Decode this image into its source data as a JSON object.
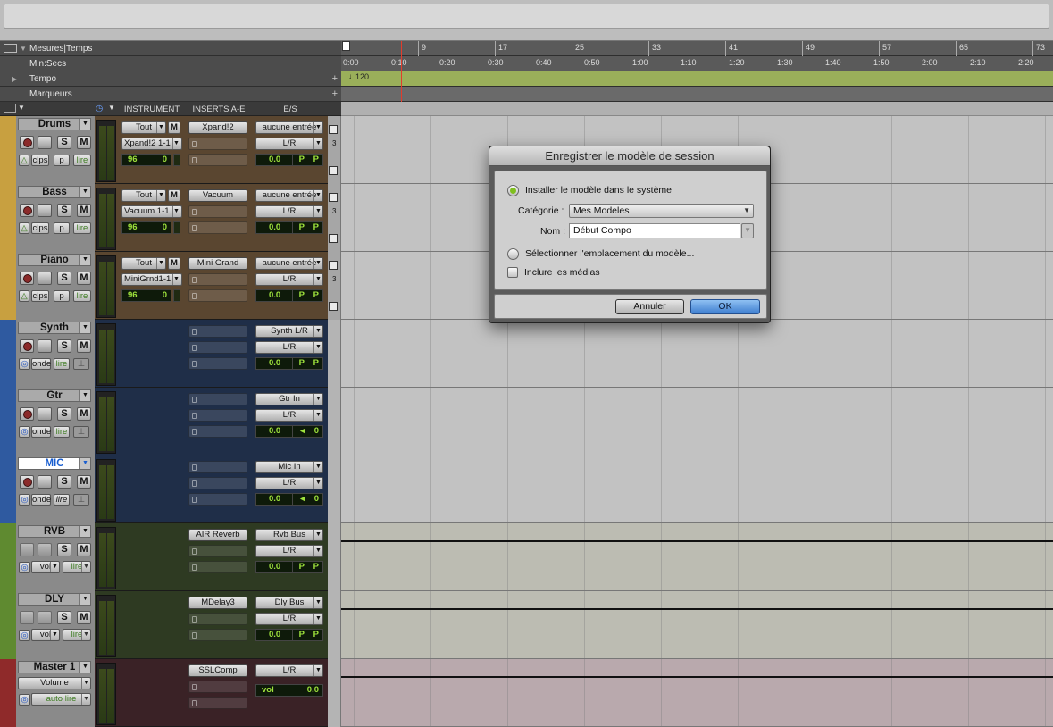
{
  "rulers": {
    "bars_label": "Mesures|Temps",
    "minsecs_label": "Min:Secs",
    "tempo_label": "Tempo",
    "markers_label": "Marqueurs",
    "tempo_value": "120",
    "bar_ticks": [
      "9",
      "17",
      "25",
      "33",
      "41",
      "49",
      "57",
      "65",
      "73"
    ],
    "time_ticks": [
      "0:00",
      "0:10",
      "0:20",
      "0:30",
      "0:40",
      "0:50",
      "1:00",
      "1:10",
      "1:20",
      "1:30",
      "1:40",
      "1:50",
      "2:00",
      "2:10",
      "2:20"
    ]
  },
  "mix_header": {
    "instrument": "INSTRUMENT",
    "inserts": "INSERTS A-E",
    "io": "E/S"
  },
  "tracks": [
    {
      "name": "Drums",
      "instr": "Tout",
      "plugin": "Xpand!2 1-1",
      "vol": "96",
      "pan": "0",
      "insert": "Xpand!2",
      "io_in": "aucune entrée",
      "io_out": "L/R",
      "fader": "0.0",
      "t1": "clps",
      "t2": "p",
      "t3": "lire"
    },
    {
      "name": "Bass",
      "instr": "Tout",
      "plugin": "Vacuum 1-1",
      "vol": "96",
      "pan": "0",
      "insert": "Vacuum",
      "io_in": "aucune entrée",
      "io_out": "L/R",
      "fader": "0.0",
      "t1": "clps",
      "t2": "p",
      "t3": "lire"
    },
    {
      "name": "Piano",
      "instr": "Tout",
      "plugin": "MiniGrnd1-1",
      "vol": "96",
      "pan": "0",
      "insert": "Mini Grand",
      "io_in": "aucune entrée",
      "io_out": "L/R",
      "fader": "0.0",
      "t1": "clps",
      "t2": "p",
      "t3": "lire"
    },
    {
      "name": "Synth",
      "io_in": "Synth L/R",
      "io_out": "L/R",
      "fader": "0.0",
      "t1": "onde",
      "t3": "lire"
    },
    {
      "name": "Gtr",
      "io_in": "Gtr In",
      "io_out": "L/R",
      "fader": "0.0",
      "pan": "0",
      "t1": "onde",
      "t3": "lire"
    },
    {
      "name": "MIC",
      "io_in": "Mic In",
      "io_out": "L/R",
      "fader": "0.0",
      "pan": "0",
      "t1": "onde",
      "t3": "lire"
    },
    {
      "name": "RVB",
      "insert": "AIR Reverb",
      "io_in": "Rvb Bus",
      "io_out": "L/R",
      "fader": "0.0",
      "t1": "vol",
      "t3": "lire"
    },
    {
      "name": "DLY",
      "insert": "MDelay3",
      "io_in": "Dly Bus",
      "io_out": "L/R",
      "fader": "0.0",
      "t1": "vol",
      "t3": "lire"
    },
    {
      "name": "Master 1",
      "insert": "SSLComp",
      "io_in": "L/R",
      "vol_label": "vol",
      "fader": "0.0",
      "t1": "Volume",
      "t3": "auto lire"
    }
  ],
  "letters": {
    "s": "S",
    "m": "M",
    "p": "P",
    "r": "3"
  },
  "dialog": {
    "title": "Enregistrer le modèle de session",
    "radio_install": "Installer le modèle dans le système",
    "category_label": "Catégorie :",
    "category_value": "Mes Modeles",
    "name_label": "Nom :",
    "name_value": "Début Compo",
    "radio_location": "Sélectionner l'emplacement du modèle...",
    "include_media": "Inclure les médias",
    "cancel": "Annuler",
    "ok": "OK"
  },
  "colors": {
    "instrument_strip": "#c8a040",
    "audio_strip": "#2f5aa0",
    "aux_strip": "#5f8a30",
    "master_strip": "#8f2a2a",
    "ok_button": "#5b95d8"
  }
}
